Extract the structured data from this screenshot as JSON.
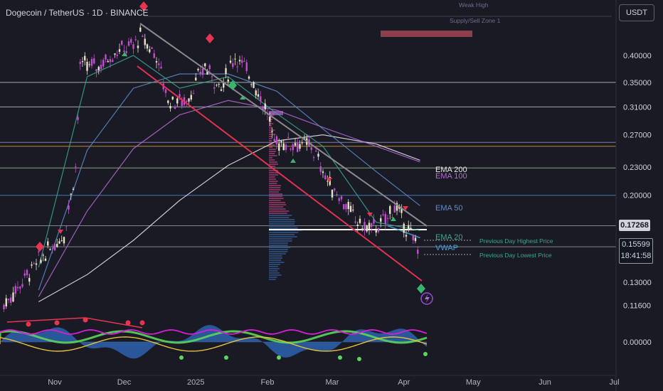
{
  "header": {
    "title": "Dogecoin / TetherUS · 1D · BINANCE",
    "currency_button": "USDT"
  },
  "price_tags": {
    "line_price": "0.17268",
    "last_price": "0.15599",
    "countdown": "18:41:58"
  },
  "chart_data": {
    "type": "line",
    "title": "Dogecoin / TetherUS · 1D · BINANCE",
    "y_axis": {
      "scale": "log",
      "tick_labels": [
        "0.40000",
        "0.35000",
        "0.31000",
        "0.27000",
        "0.23000",
        "0.20000",
        "0.17268",
        "0.15599",
        "0.13000",
        "0.11600",
        "0.00000"
      ]
    },
    "x_axis": {
      "tick_labels": [
        "Nov",
        "Dec",
        "2025",
        "Feb",
        "Mar",
        "Apr",
        "May",
        "Jun",
        "Jul"
      ]
    },
    "series": [
      {
        "name": "EMA 200",
        "color": "#e8e8e8",
        "x": [
          "2024-10-25",
          "2024-11-15",
          "2024-12-05",
          "2024-12-25",
          "2025-01-15",
          "2025-02-05",
          "2025-02-25",
          "2025-03-20",
          "2025-04-08"
        ],
        "y": [
          0.118,
          0.135,
          0.16,
          0.195,
          0.232,
          0.262,
          0.27,
          0.258,
          0.238
        ]
      },
      {
        "name": "EMA 100",
        "color": "#b36bd6",
        "x": [
          "2024-10-25",
          "2024-11-15",
          "2024-12-05",
          "2024-12-25",
          "2025-01-15",
          "2025-02-05",
          "2025-02-25",
          "2025-03-20",
          "2025-04-08"
        ],
        "y": [
          0.121,
          0.185,
          0.252,
          0.298,
          0.32,
          0.305,
          0.28,
          0.255,
          0.236
        ]
      },
      {
        "name": "EMA 50",
        "color": "#5b8ec9",
        "x": [
          "2024-10-25",
          "2024-11-15",
          "2024-12-05",
          "2024-12-25",
          "2025-01-15",
          "2025-02-05",
          "2025-02-25",
          "2025-03-20",
          "2025-04-08"
        ],
        "y": [
          0.125,
          0.25,
          0.34,
          0.365,
          0.365,
          0.335,
          0.278,
          0.225,
          0.19
        ]
      },
      {
        "name": "EMA 20",
        "color": "#3aa890",
        "x": [
          "2024-10-25",
          "2024-11-15",
          "2024-12-05",
          "2024-12-25",
          "2025-01-15",
          "2025-02-05",
          "2025-02-25",
          "2025-03-20",
          "2025-04-08"
        ],
        "y": [
          0.14,
          0.36,
          0.4,
          0.34,
          0.36,
          0.3,
          0.255,
          0.175,
          0.168
        ]
      },
      {
        "name": "VWAP",
        "color": "#4aa3df",
        "x": [
          "2025-03-25",
          "2025-04-08"
        ],
        "y": [
          0.172,
          0.162
        ]
      }
    ],
    "horizontal_levels": [
      {
        "price": 0.35,
        "color": "#c8d6b9"
      },
      {
        "price": 0.31,
        "color": "#c9c9c9"
      },
      {
        "price": 0.26,
        "color": "#9b8fd0"
      },
      {
        "price": 0.255,
        "color": "#e0a52e"
      },
      {
        "price": 0.229,
        "color": "#a3c586"
      },
      {
        "price": 0.2,
        "color": "#4c8fd6"
      },
      {
        "price": 0.172,
        "color": "#9aa0a6"
      },
      {
        "price": 0.155,
        "color": "#9aa0a6"
      }
    ],
    "annotations": [
      {
        "text": "Weak High",
        "color": "#6b6f86"
      },
      {
        "text": "Supply/Sell Zone 1",
        "color": "#6b6f86"
      },
      {
        "text": "Previous Day Highest Price",
        "color": "#3aa890"
      },
      {
        "text": "Previous Day Lowest Price",
        "color": "#3aa890"
      }
    ],
    "grid": false,
    "legend": "right-of-series"
  }
}
